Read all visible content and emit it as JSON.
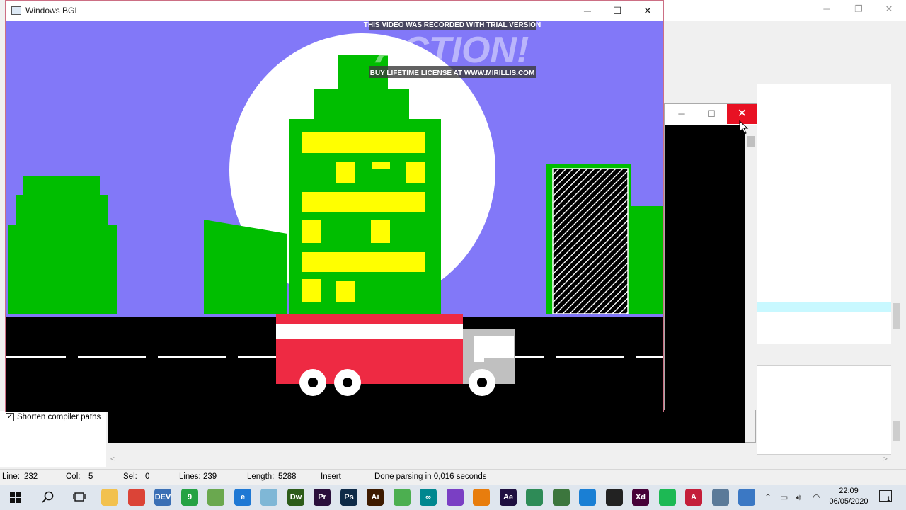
{
  "bgi_window": {
    "title": "Windows BGI",
    "minimize_glyph": "─",
    "maximize_glyph": "☐",
    "close_glyph": "✕"
  },
  "console_window": {
    "minimize_glyph": "─",
    "maximize_glyph": "☐",
    "close_glyph": "✕"
  },
  "watermark": {
    "top_text": "THIS VIDEO WAS RECORDED WITH TRIAL VERSION",
    "logo_text": "ACTION!",
    "bottom_text": "BUY LIFETIME LICENSE AT WWW.MIRILLIS.COM"
  },
  "ide": {
    "shorten_paths_label": "Shorten compiler paths",
    "shorten_paths_checked": "✓",
    "bg_minimize_glyph": "─",
    "bg_restore_glyph": "❐",
    "bg_close_glyph": "✕",
    "scroll_left_glyph": "<",
    "scroll_right_glyph": ">"
  },
  "status_bar": {
    "line_label": "Line:",
    "line_value": "232",
    "col_label": "Col:",
    "col_value": "5",
    "sel_label": "Sel:",
    "sel_value": "0",
    "lines_label": "Lines:",
    "lines_value": "239",
    "length_label": "Length:",
    "length_value": "5288",
    "mode": "Insert",
    "message": "Done parsing in 0,016 seconds"
  },
  "taskbar": {
    "time": "22:09",
    "date": "06/05/2020",
    "notification_count": "1",
    "apps": [
      {
        "icon": "file-explorer-icon",
        "glyph": "",
        "color": "#f2c14e"
      },
      {
        "icon": "chrome-icon",
        "glyph": "",
        "color": "#db4437"
      },
      {
        "icon": "dev-cpp-icon",
        "glyph": "DEV",
        "color": "#3a6fb5"
      },
      {
        "icon": "whatsapp-icon",
        "glyph": "9",
        "color": "#25a244"
      },
      {
        "icon": "greenshot-icon",
        "glyph": "",
        "color": "#6aa84f"
      },
      {
        "icon": "edge-icon",
        "glyph": "e",
        "color": "#1e78d4"
      },
      {
        "icon": "notepad-icon",
        "glyph": "",
        "color": "#7fb7d6"
      },
      {
        "icon": "dreamweaver-icon",
        "glyph": "Dw",
        "color": "#2d5c1a"
      },
      {
        "icon": "premiere-icon",
        "glyph": "Pr",
        "color": "#2a0f3b"
      },
      {
        "icon": "photoshop-icon",
        "glyph": "Ps",
        "color": "#0e2a47"
      },
      {
        "icon": "illustrator-icon",
        "glyph": "Ai",
        "color": "#3d1a00"
      },
      {
        "icon": "sublime-icon",
        "glyph": "",
        "color": "#4caf50"
      },
      {
        "icon": "arduino-icon",
        "glyph": "∞",
        "color": "#00878f"
      },
      {
        "icon": "visual-studio-icon",
        "glyph": "",
        "color": "#7a3fc4"
      },
      {
        "icon": "blender-icon",
        "glyph": "",
        "color": "#e87d0d"
      },
      {
        "icon": "after-effects-icon",
        "glyph": "Ae",
        "color": "#1f0f40"
      },
      {
        "icon": "maps-icon",
        "glyph": "",
        "color": "#2e8b57"
      },
      {
        "icon": "terrain-icon",
        "glyph": "",
        "color": "#3c763d"
      },
      {
        "icon": "vscode-icon",
        "glyph": "",
        "color": "#1a7fd4"
      },
      {
        "icon": "unity-icon",
        "glyph": "",
        "color": "#222222"
      },
      {
        "icon": "xd-icon",
        "glyph": "Xd",
        "color": "#470137"
      },
      {
        "icon": "spotify-icon",
        "glyph": "",
        "color": "#1db954"
      },
      {
        "icon": "action-recorder-icon",
        "glyph": "A",
        "color": "#c41e3a"
      },
      {
        "icon": "window-app-icon",
        "glyph": "",
        "color": "#5b7a99"
      },
      {
        "icon": "bgi-app-icon",
        "glyph": "",
        "color": "#3b78c4"
      }
    ]
  },
  "colors": {
    "sky": "#8278f8",
    "green": "#00be00",
    "yellow": "#ffff00",
    "road": "#000000",
    "truck_red": "#ee2a43",
    "truck_grey": "#c0c0c0",
    "close_red": "#e81123"
  }
}
